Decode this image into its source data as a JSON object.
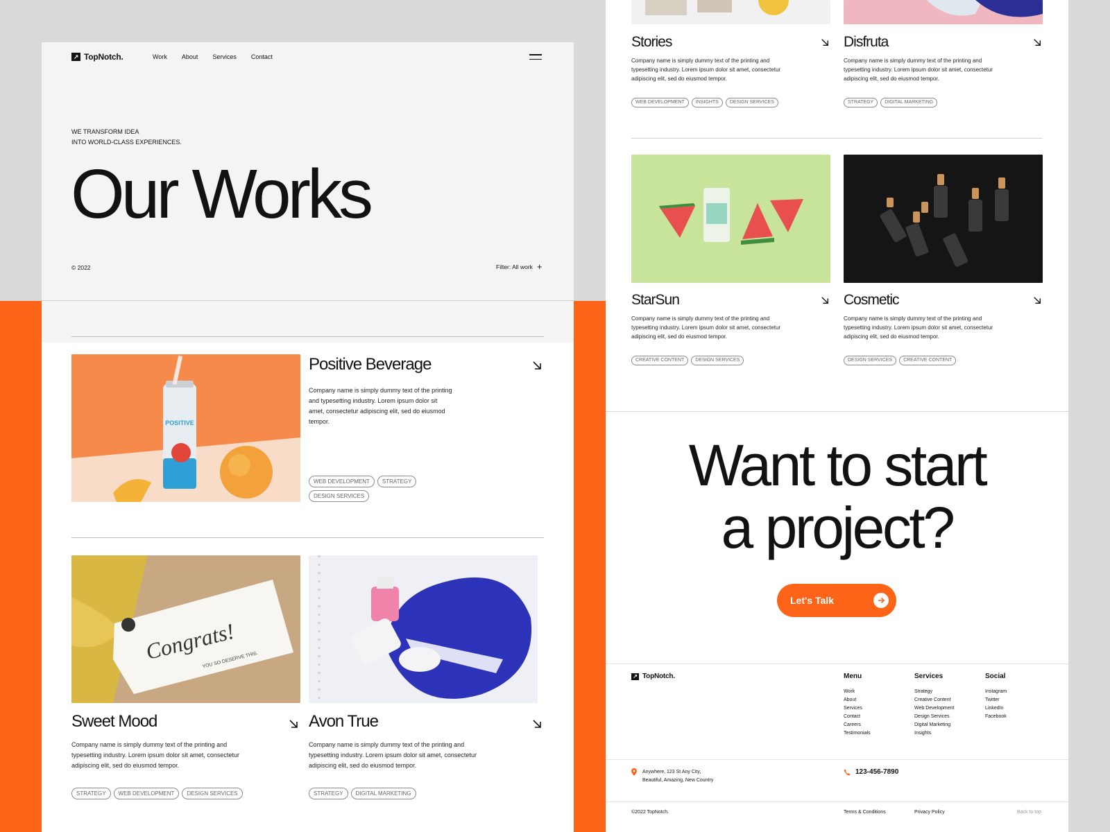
{
  "header": {
    "logo": "TopNotch.",
    "nav": [
      "Work",
      "About",
      "Services",
      "Contact"
    ]
  },
  "hero": {
    "tagline_line1": "WE TRANSFORM IDEA",
    "tagline_line2": "INTO WORLD-CLASS EXPERIENCES.",
    "title": "Our Works",
    "copyright": "© 2022",
    "filter": "Filter: All work"
  },
  "projects": [
    {
      "title": "Positive Beverage",
      "desc": "Company name is simply dummy text of the printing and typesetting industry. Lorem ipsum dolor sit amet, consectetur adipiscing elit, sed do eiusmod tempor.",
      "tags": [
        "WEB DEVELOPMENT",
        "STRATEGY",
        "DESIGN SERVICES"
      ]
    },
    {
      "title": "Sweet Mood",
      "desc": "Company name is simply dummy text of the printing and typesetting industry. Lorem ipsum dolor sit amet, consectetur adipiscing elit, sed do eiusmod tempor.",
      "tags": [
        "STRATEGY",
        "WEB DEVELOPMENT",
        "DESIGN SERVICES"
      ],
      "image_text": "Congrats!",
      "image_subtext": "YOU SO DESERVE THIS."
    },
    {
      "title": "Avon True",
      "desc": "Company name is simply dummy text of the printing and typesetting industry. Lorem ipsum dolor sit amet, consectetur adipiscing elit, sed do eiusmod tempor.",
      "tags": [
        "STRATEGY",
        "DIGITAL MARKETING"
      ]
    },
    {
      "title": "Stories",
      "desc": "Company name is simply dummy text of the printing and typesetting industry. Lorem ipsum dolor sit amet, consectetur adipiscing elit, sed do eiusmod tempor.",
      "tags": [
        "WEB DEVELOPMENT",
        "INSIGHTS",
        "DESIGN SERVICES"
      ]
    },
    {
      "title": "Disfruta",
      "desc": "Company name is simply dummy text of the printing and typesetting industry. Lorem ipsum dolor sit amet, consectetur adipiscing elit, sed do eiusmod tempor.",
      "tags": [
        "STRATEGY",
        "DIGITAL MARKETING"
      ]
    },
    {
      "title": "StarSun",
      "desc": "Company name is simply dummy text of the printing and typesetting industry. Lorem ipsum dolor sit amet, consectetur adipiscing elit, sed do eiusmod tempor.",
      "tags": [
        "CREATIVE CONTENT",
        "DESIGN SERVICES"
      ]
    },
    {
      "title": "Cosmetic",
      "desc": "Company name is simply dummy text of the printing and typesetting industry. Lorem ipsum dolor sit amet, consectetur adipiscing elit, sed do eiusmod tempor.",
      "tags": [
        "DESIGN SERVICES",
        "CREATIVE CONTENT"
      ]
    }
  ],
  "cta": {
    "line1": "Want to start",
    "line2": "a project?",
    "button": "Let's Talk"
  },
  "footer": {
    "logo": "TopNotch.",
    "menu": {
      "heading": "Menu",
      "links": [
        "Work",
        "About",
        "Services",
        "Contact",
        "Careers",
        "Testimonials"
      ]
    },
    "services": {
      "heading": "Services",
      "links": [
        "Strategy",
        "Creative Content",
        "Web Development",
        "Design Services",
        "Digital Marketing",
        "Insights"
      ]
    },
    "social": {
      "heading": "Social",
      "links": [
        "Instagram",
        "Twitter",
        "LinkedIn",
        "Facebook"
      ]
    },
    "address_line1": "Anywhere, 123 St Any City,",
    "address_line2": "Beautiful, Amazing, New Country",
    "phone": "123-456-7890",
    "copyright": "©2022 TopNotch.",
    "terms": "Terms & Conditions",
    "privacy": "Privacy Policy",
    "back_to_top": "Back to top"
  },
  "colors": {
    "accent": "#fe6418",
    "text": "#121212",
    "hero_bg": "#f4f4f4",
    "outer_bg": "#d9d9d9"
  }
}
